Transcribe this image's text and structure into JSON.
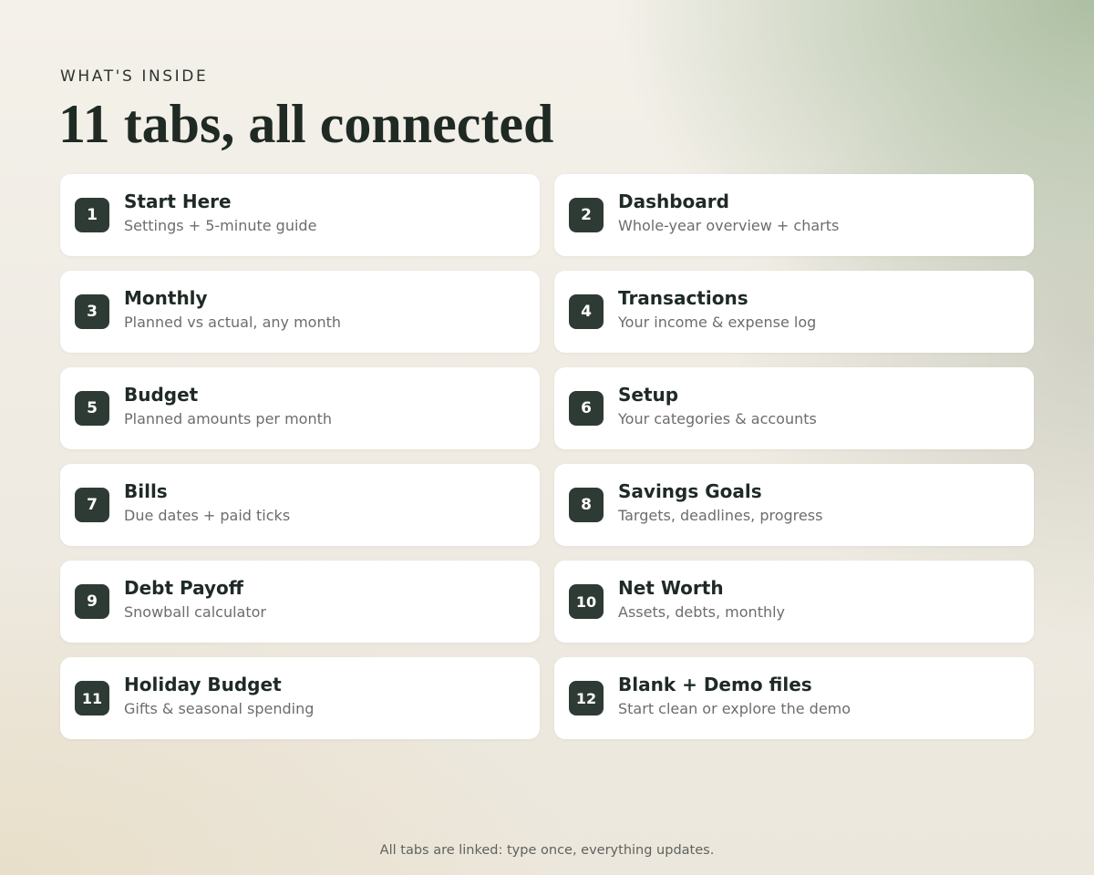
{
  "header": {
    "eyebrow": "WHAT'S INSIDE",
    "headline": "11 tabs, all connected"
  },
  "tabs": [
    {
      "number": "1",
      "title": "Start Here",
      "subtitle": "Settings + 5-minute guide"
    },
    {
      "number": "2",
      "title": "Dashboard",
      "subtitle": "Whole-year overview + charts"
    },
    {
      "number": "3",
      "title": "Monthly",
      "subtitle": "Planned vs actual, any month"
    },
    {
      "number": "4",
      "title": "Transactions",
      "subtitle": "Your income & expense log"
    },
    {
      "number": "5",
      "title": "Budget",
      "subtitle": "Planned amounts per month"
    },
    {
      "number": "6",
      "title": "Setup",
      "subtitle": "Your categories & accounts"
    },
    {
      "number": "7",
      "title": "Bills",
      "subtitle": "Due dates + paid ticks"
    },
    {
      "number": "8",
      "title": "Savings Goals",
      "subtitle": "Targets, deadlines, progress"
    },
    {
      "number": "9",
      "title": "Debt Payoff",
      "subtitle": "Snowball calculator"
    },
    {
      "number": "10",
      "title": "Net Worth",
      "subtitle": "Assets, debts, monthly"
    },
    {
      "number": "11",
      "title": "Holiday Budget",
      "subtitle": "Gifts & seasonal spending"
    },
    {
      "number": "12",
      "title": "Blank + Demo files",
      "subtitle": "Start clean or explore the demo"
    }
  ],
  "footer": {
    "note": "All tabs are linked: type once, everything updates."
  },
  "colors": {
    "badge": "#2e3b35",
    "card": "#ffffff",
    "heading": "#1f2a24",
    "subtitle": "#6b6e6a"
  }
}
